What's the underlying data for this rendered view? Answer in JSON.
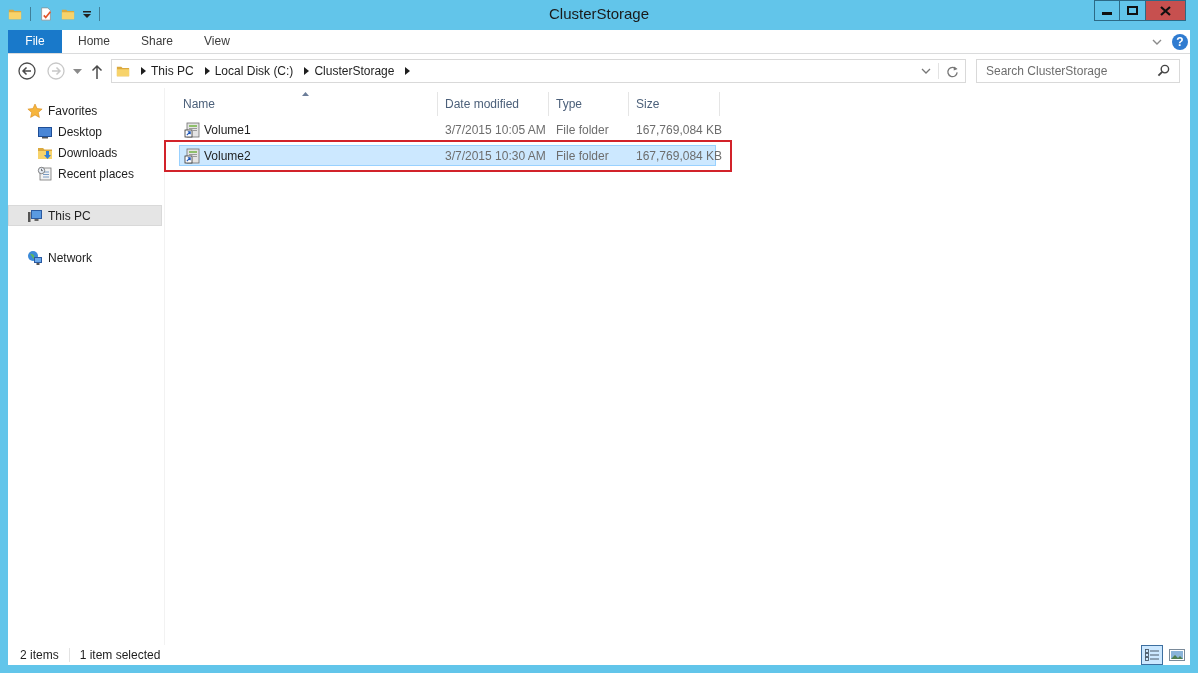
{
  "window": {
    "title": "ClusterStorage"
  },
  "ribbon": {
    "tabs": [
      {
        "label": "File",
        "kind": "file",
        "selected": false
      },
      {
        "label": "Home",
        "kind": "tab",
        "selected": false
      },
      {
        "label": "Share",
        "kind": "tab",
        "selected": false
      },
      {
        "label": "View",
        "kind": "tab",
        "selected": false
      }
    ],
    "help": "?"
  },
  "navigation": [
    {
      "kind": "back",
      "disabled": false
    },
    {
      "kind": "forward",
      "disabled": true
    },
    {
      "kind": "recent",
      "disabled": false
    },
    {
      "kind": "up",
      "disabled": false
    }
  ],
  "address_bar": {
    "path": [
      "This PC",
      "Local Disk (C:)",
      "ClusterStorage"
    ]
  },
  "search": {
    "placeholder": "Search ClusterStorage"
  },
  "sidebar": {
    "items": [
      {
        "label": "Favorites",
        "kind": "favorites",
        "selected": false,
        "children": [
          {
            "label": "Desktop",
            "kind": "desktop",
            "selected": false
          },
          {
            "label": "Downloads",
            "kind": "downloads",
            "selected": false
          },
          {
            "label": "Recent places",
            "kind": "recent",
            "selected": false
          }
        ]
      },
      {
        "label": "This PC",
        "kind": "pc",
        "selected": true
      },
      {
        "label": "Network",
        "kind": "network",
        "selected": false
      }
    ]
  },
  "table": {
    "columns": [
      {
        "label": "Name",
        "sorted": true
      },
      {
        "label": "Date modified",
        "sorted": false
      },
      {
        "label": "Type",
        "sorted": false
      },
      {
        "label": "Size",
        "sorted": false
      }
    ],
    "rows": [
      {
        "name": "Volume1",
        "date_modified": "3/7/2015 10:05 AM",
        "type": "File folder",
        "size": "167,769,084 KB",
        "selected": false,
        "highlighted": false
      },
      {
        "name": "Volume2",
        "date_modified": "3/7/2015 10:30 AM",
        "type": "File folder",
        "size": "167,769,084 KB",
        "selected": true,
        "highlighted": true
      }
    ]
  },
  "status_bar": {
    "item_count": "2 items",
    "selection": "1 item selected",
    "views": [
      {
        "kind": "details",
        "selected": true
      },
      {
        "kind": "large_icons",
        "selected": false
      }
    ]
  }
}
